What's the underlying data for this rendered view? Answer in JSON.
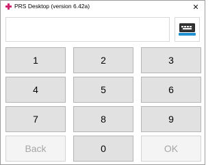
{
  "window": {
    "title": "PRS Desktop (version 6.42a)",
    "icon": "pink-plus-icon",
    "close_label": "✕",
    "accent_color": "#d0236e"
  },
  "display": {
    "value": "",
    "keyboard_button_icon": "keyboard-icon"
  },
  "keypad": {
    "k1": "1",
    "k2": "2",
    "k3": "3",
    "k4": "4",
    "k5": "5",
    "k6": "6",
    "k7": "7",
    "k8": "8",
    "k9": "9",
    "back": "Back",
    "k0": "0",
    "ok": "OK"
  }
}
